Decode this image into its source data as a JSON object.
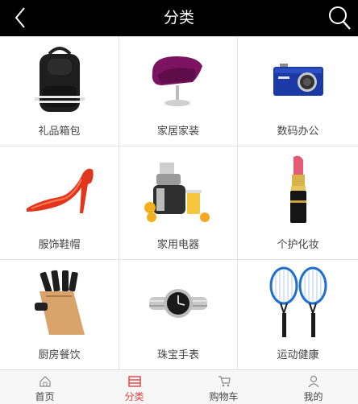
{
  "header": {
    "title": "分类",
    "back_icon": "chevron-left-icon",
    "search_icon": "search-icon"
  },
  "categories": [
    {
      "label": "礼品箱包",
      "icon": "backpack-image"
    },
    {
      "label": "家居家装",
      "icon": "chair-image"
    },
    {
      "label": "数码办公",
      "icon": "camera-image"
    },
    {
      "label": "服饰鞋帽",
      "icon": "high-heel-image"
    },
    {
      "label": "家用电器",
      "icon": "juicer-image"
    },
    {
      "label": "个护化妆",
      "icon": "lipstick-image"
    },
    {
      "label": "厨房餐饮",
      "icon": "knife-block-image"
    },
    {
      "label": "珠宝手表",
      "icon": "watch-image"
    },
    {
      "label": "运动健康",
      "icon": "tennis-racket-image"
    }
  ],
  "tabbar": {
    "active_color": "#e8403a",
    "items": [
      {
        "label": "首页",
        "icon": "home-icon",
        "active": false
      },
      {
        "label": "分类",
        "icon": "category-icon",
        "active": true
      },
      {
        "label": "购物车",
        "icon": "cart-icon",
        "active": false
      },
      {
        "label": "我的",
        "icon": "user-icon",
        "active": false
      }
    ]
  }
}
